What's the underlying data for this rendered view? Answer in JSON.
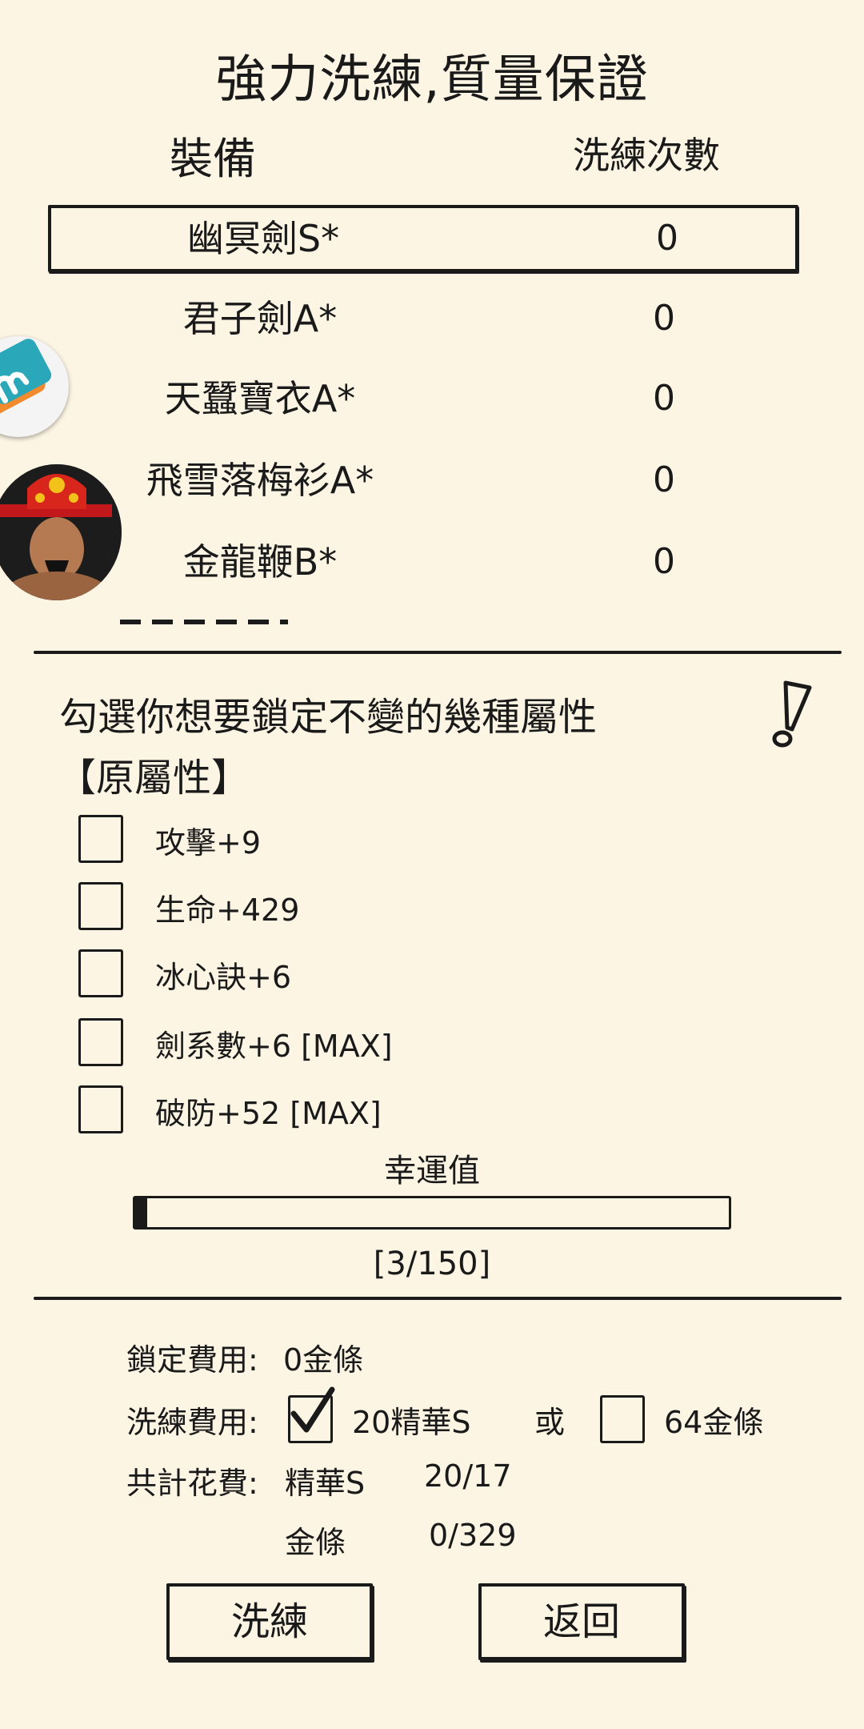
{
  "title": "強力洗練,質量保證",
  "columns": {
    "equipment": "裝備",
    "refine_count": "洗練次數"
  },
  "equipment": [
    {
      "name": "幽冥劍S*",
      "count": "0"
    },
    {
      "name": "君子劍A*",
      "count": "0"
    },
    {
      "name": "天蠶寶衣A*",
      "count": "0"
    },
    {
      "name": "飛雪落梅衫A*",
      "count": "0"
    },
    {
      "name": "金龍鞭B*",
      "count": "0"
    }
  ],
  "lock_prompt": "勾選你想要鎖定不變的幾種屬性",
  "original_attr_label": "【原屬性】",
  "attributes": [
    {
      "label": "攻擊+9",
      "checked": false
    },
    {
      "label": "生命+429",
      "checked": false
    },
    {
      "label": "冰心訣+6",
      "checked": false
    },
    {
      "label": "劍系數+6   [MAX]",
      "checked": false
    },
    {
      "label": "破防+52   [MAX]",
      "checked": false
    }
  ],
  "luck": {
    "label": "幸運值",
    "text": "[3/150]",
    "value": 3,
    "max": 150
  },
  "costs": {
    "lock_label": "鎖定費用:",
    "lock_value": "0金條",
    "refine_label": "洗練費用:",
    "refine_option1": "20精華S",
    "refine_option1_checked": true,
    "or_text": "或",
    "refine_option2": "64金條",
    "refine_option2_checked": false,
    "total_label": "共計花費:",
    "total_item1_name": "精華S",
    "total_item1_value": "20/17",
    "total_item2_name": "金條",
    "total_item2_value": "0/329"
  },
  "buttons": {
    "refine": "洗練",
    "back": "返回"
  },
  "colors": {
    "background": "#fdf5e4",
    "ink": "#1a1a1a"
  }
}
